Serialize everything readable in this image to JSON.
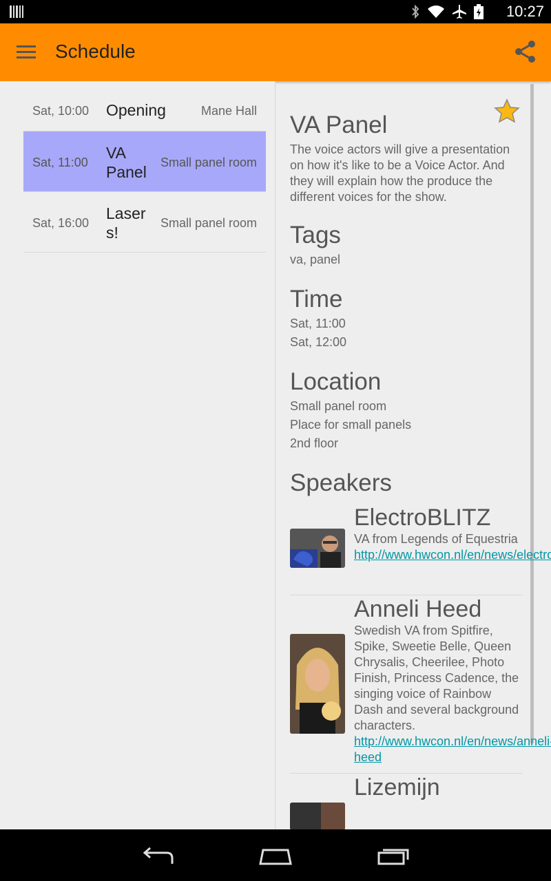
{
  "status_bar": {
    "time": "10:27"
  },
  "app_bar": {
    "title": "Schedule",
    "menu_icon": "hamburger-menu-icon",
    "share_icon": "share-icon",
    "color": "#ff8c00"
  },
  "schedule": [
    {
      "time": "Sat, 10:00",
      "name": "Opening",
      "room": "Mane Hall",
      "selected": false
    },
    {
      "time": "Sat, 11:00",
      "name": "VA Panel",
      "room": "Small panel room",
      "selected": true
    },
    {
      "time": "Sat, 16:00",
      "name": "Lasers!",
      "room": "Small panel room",
      "selected": false
    }
  ],
  "selection_color": "#a8a8fa",
  "detail": {
    "title": "VA Panel",
    "description": "The voice actors will give a presentation on how it's like to be a Voice Actor. And they will explain how the produce the different voices for the show.",
    "tags_heading": "Tags",
    "tags": "va, panel",
    "time_heading": "Time",
    "time_start": "Sat, 11:00",
    "time_end": "Sat, 12:00",
    "location_heading": "Location",
    "location_name": "Small panel room",
    "location_desc": "Place for small panels",
    "location_floor": "2nd floor",
    "speakers_heading": "Speakers",
    "speakers": [
      {
        "name": "ElectroBLITZ",
        "description": "VA from Legends of Equestria",
        "link": "http://www.hwcon.nl/en/news/electroblitz"
      },
      {
        "name": "Anneli Heed",
        "description": "Swedish VA from Spitfire, Spike, Sweetie Belle, Queen Chrysalis, Cheerilee, Photo Finish, Princess Cadence, the singing voice of Rainbow Dash and several background characters.",
        "link": "http://www.hwcon.nl/en/news/anneli-heed"
      },
      {
        "name": "Lizemijn"
      }
    ],
    "favorite_icon": "star-icon",
    "link_color": "#0097a7"
  },
  "nav_bar": {
    "back_icon": "back-icon",
    "home_icon": "home-icon",
    "recents_icon": "recents-icon"
  }
}
